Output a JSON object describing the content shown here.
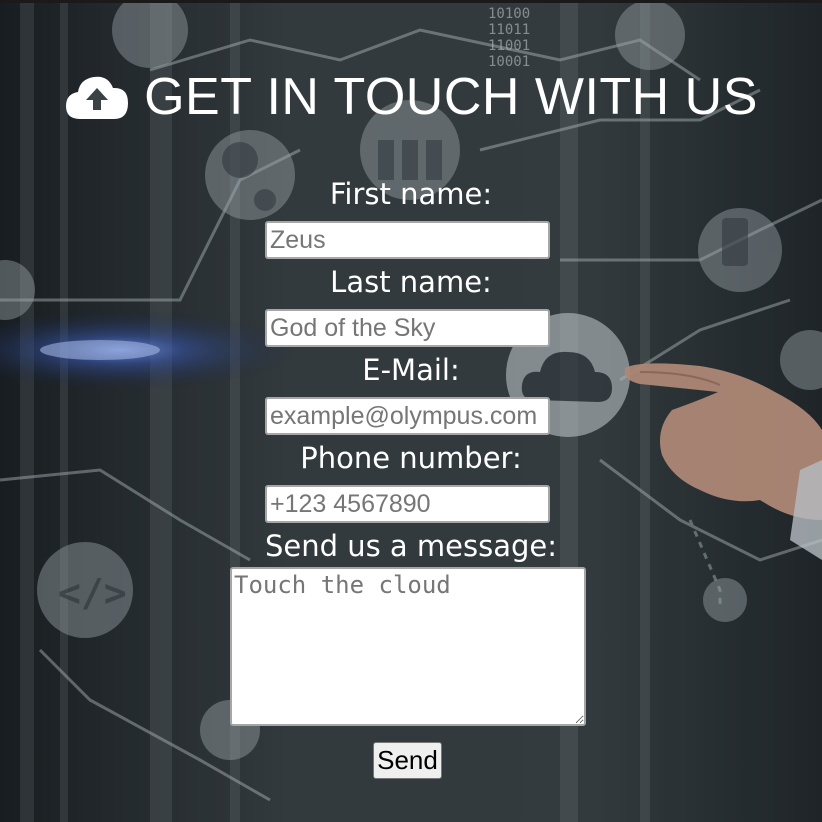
{
  "header": {
    "icon": "cloud-upload-icon",
    "title": "GET IN TOUCH WITH US"
  },
  "form": {
    "first_name": {
      "label": "First name:",
      "placeholder": "Zeus"
    },
    "last_name": {
      "label": "Last name:",
      "placeholder": "God of the Sky"
    },
    "email": {
      "label": "E-Mail:",
      "placeholder": "example@olympus.com"
    },
    "phone": {
      "label": "Phone number:",
      "placeholder": "+123 4567890"
    },
    "message": {
      "label": "Send us a message:",
      "placeholder": "Touch the cloud"
    },
    "submit_label": "Send"
  },
  "background": {
    "description_icons": [
      "chip-icon",
      "gear-icon",
      "server-icon",
      "cloud-icon",
      "phone-icon",
      "code-icon",
      "network-icon",
      "hand-pointing"
    ],
    "binary_text": "10100 11011 11001 10001"
  },
  "colors": {
    "background": "#2b3236",
    "text": "#ffffff",
    "input_border": "#a6a6a6",
    "button": "#efefef"
  }
}
